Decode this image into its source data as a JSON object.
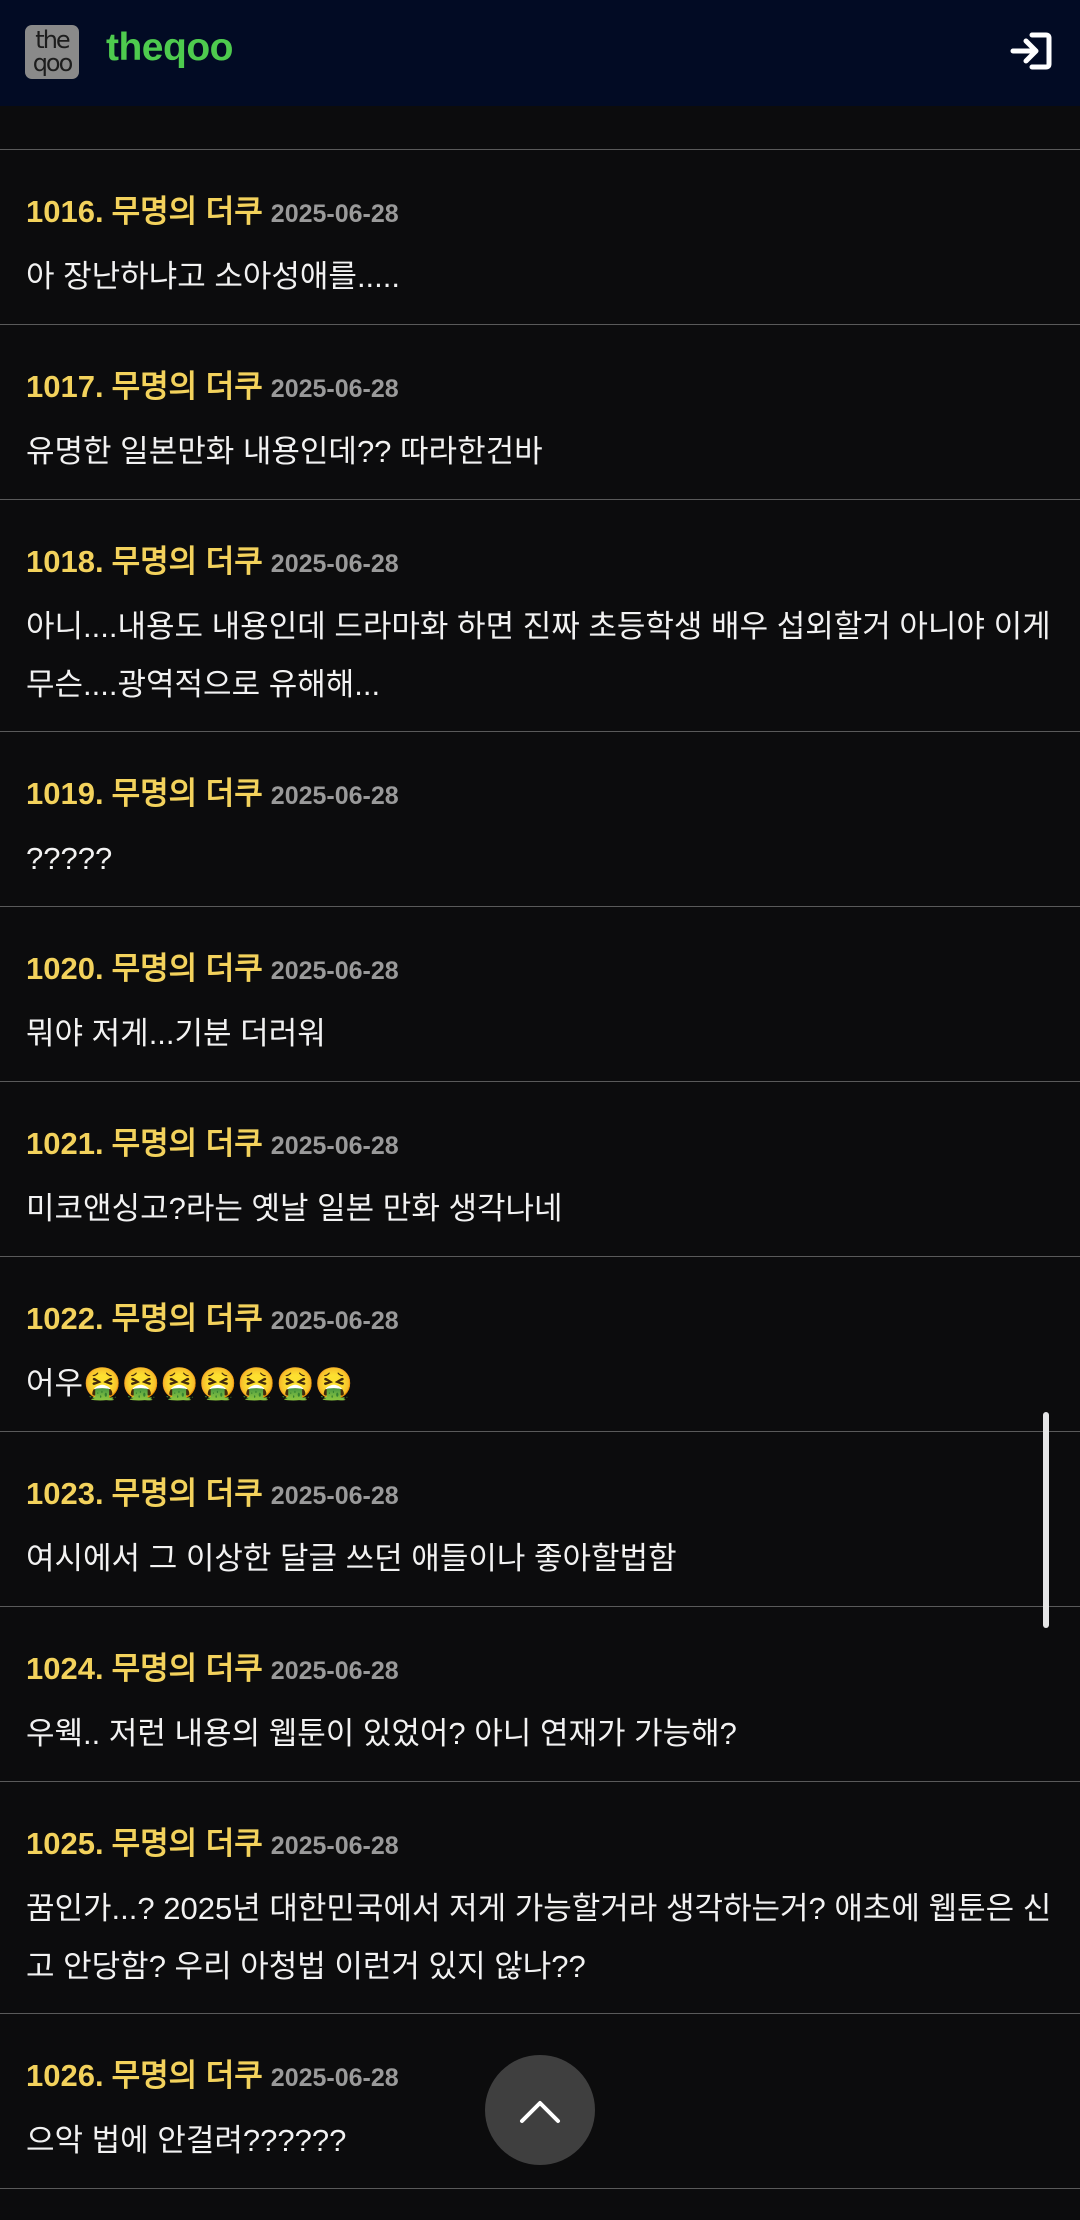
{
  "header": {
    "logo_lines": [
      "the",
      "qoo"
    ],
    "brand": "theqoo",
    "login_icon": "login-icon"
  },
  "comments": [
    {
      "num": "1016.",
      "author": "무명의 더쿠",
      "date": "2025-06-28",
      "text": "아 장난하냐고 소아성애를....."
    },
    {
      "num": "1017.",
      "author": "무명의 더쿠",
      "date": "2025-06-28",
      "text": "유명한 일본만화 내용인데?? 따라한건바"
    },
    {
      "num": "1018.",
      "author": "무명의 더쿠",
      "date": "2025-06-28",
      "text": "아니....내용도 내용인데 드라마화 하면 진짜 초등학생 배우 섭외할거 아니야 이게 무슨....광역적으로 유해해..."
    },
    {
      "num": "1019.",
      "author": "무명의 더쿠",
      "date": "2025-06-28",
      "text": "?????"
    },
    {
      "num": "1020.",
      "author": "무명의 더쿠",
      "date": "2025-06-28",
      "text": "뭐야 저게...기분 더러워"
    },
    {
      "num": "1021.",
      "author": "무명의 더쿠",
      "date": "2025-06-28",
      "text": "미코앤싱고?라는 옛날 일본 만화 생각나네"
    },
    {
      "num": "1022.",
      "author": "무명의 더쿠",
      "date": "2025-06-28",
      "text": "어우🤮🤮🤮🤮🤮🤮🤮"
    },
    {
      "num": "1023.",
      "author": "무명의 더쿠",
      "date": "2025-06-28",
      "text": "여시에서 그 이상한 달글 쓰던 애들이나 좋아할법함"
    },
    {
      "num": "1024.",
      "author": "무명의 더쿠",
      "date": "2025-06-28",
      "text": "우웩.. 저런 내용의 웹툰이 있었어? 아니 연재가 가능해?"
    },
    {
      "num": "1025.",
      "author": "무명의 더쿠",
      "date": "2025-06-28",
      "text": "꿈인가...? 2025년 대한민국에서 저게 가능할거라 생각하는거? 애초에 웹툰은 신고 안당함? 우리 아청법 이런거 있지 않나??"
    },
    {
      "num": "1026.",
      "author": "무명의 더쿠",
      "date": "2025-06-28",
      "text": "으악 법에 안걸려??????"
    }
  ],
  "scroll_top_icon": "chevron-up-icon"
}
